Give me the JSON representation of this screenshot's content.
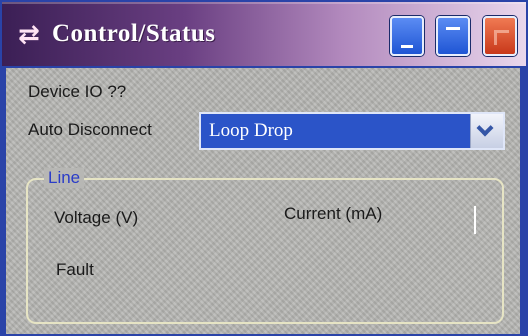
{
  "window": {
    "title": "Control/Status",
    "icon": "swap-arrows-icon",
    "colors": {
      "title_gradient_start": "#3b1f55",
      "title_gradient_end": "#e9d7ec",
      "frame": "#2a43a8",
      "selection": "#2b54c8",
      "group_legend": "#2a3cc8"
    }
  },
  "form": {
    "device_id_label": "Device IO ??",
    "auto_disconnect_label": "Auto Disconnect",
    "auto_disconnect_value": "Loop Drop"
  },
  "line_group": {
    "legend": "Line",
    "voltage_label": "Voltage (V)",
    "current_label": "Current (mA)",
    "fault_label": "Fault"
  }
}
